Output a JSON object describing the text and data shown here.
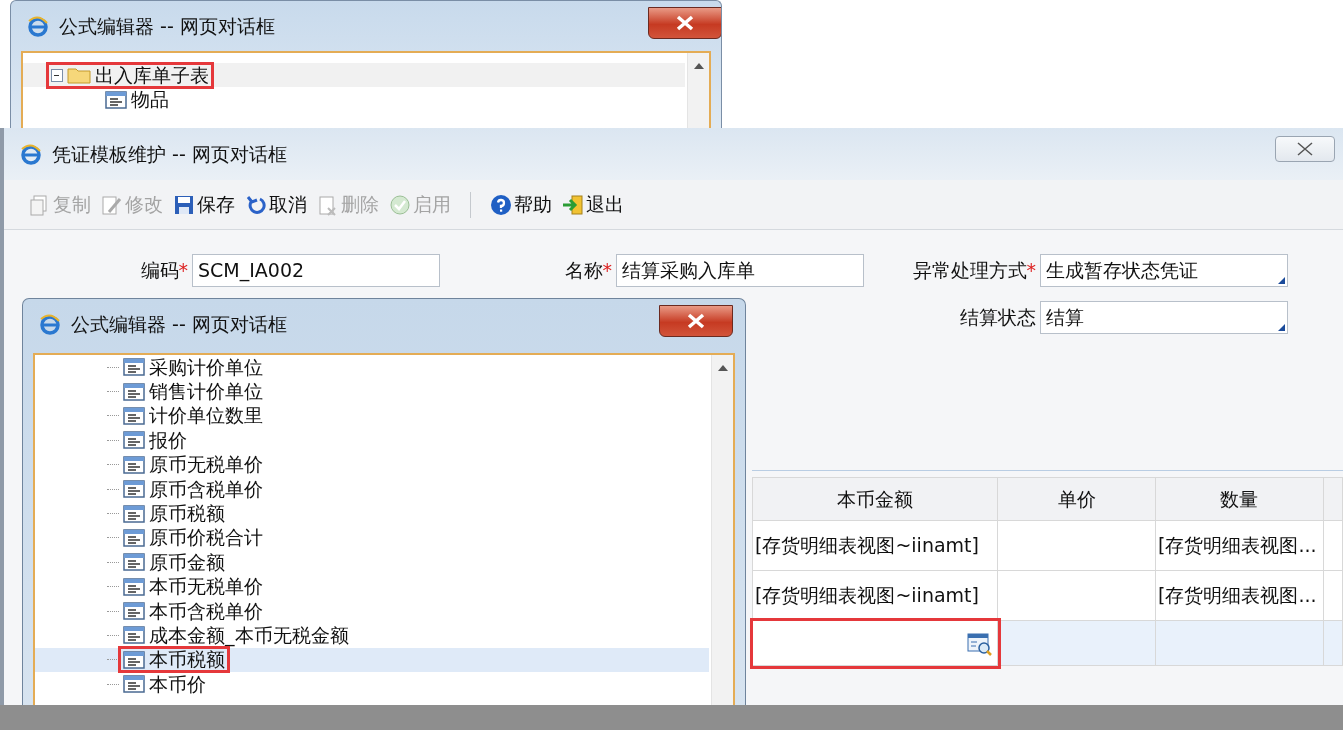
{
  "top_dialog": {
    "title": "公式编辑器 -- 网页对话框",
    "tree": [
      {
        "label": "出入库单子表",
        "kind": "folder",
        "expanded": true,
        "highlighted": true,
        "children": [
          {
            "label": "物品",
            "kind": "field",
            "highlighted": false
          }
        ]
      }
    ]
  },
  "main_window": {
    "title": "凭证模板维护 -- 网页对话框",
    "toolbar": [
      [
        {
          "label": "复制",
          "kind": "copy",
          "disabled": true
        },
        {
          "label": "修改",
          "kind": "edit",
          "disabled": true
        },
        {
          "label": "保存",
          "kind": "save",
          "disabled": false
        },
        {
          "label": "取消",
          "kind": "cancel",
          "disabled": false
        },
        {
          "label": "删除",
          "kind": "delete",
          "disabled": true
        },
        {
          "label": "启用",
          "kind": "enable",
          "disabled": true
        }
      ],
      [
        {
          "label": "帮助",
          "kind": "help",
          "disabled": false
        },
        {
          "label": "退出",
          "kind": "exit",
          "disabled": false
        }
      ]
    ],
    "form": [
      [
        {
          "label": "编码",
          "required_mark": "*",
          "kind": "text",
          "value": "SCM_IA002"
        },
        {
          "label": "名称",
          "required_mark": "*",
          "kind": "text",
          "value": "结算采购入库单"
        },
        {
          "label": "异常处理方式",
          "required_mark": "*",
          "kind": "select",
          "value": "生成暂存状态凭证"
        }
      ],
      [
        {
          "label": "结算状态",
          "kind": "select",
          "value": "结算"
        }
      ]
    ],
    "table": {
      "columns": [
        "本币金额",
        "单价",
        "数量"
      ],
      "rows": [
        {
          "editing": false,
          "cells": [
            "[存货明细表视图~iinamt]",
            "",
            "[存货明细表视图..."
          ]
        },
        {
          "editing": false,
          "cells": [
            "[存货明细表视图~iinamt]",
            "",
            "[存货明细表视图..."
          ]
        },
        {
          "editing": true,
          "highlighted": true,
          "cells": [
            "",
            "",
            ""
          ]
        }
      ]
    }
  },
  "formula_dialog": {
    "title": "公式编辑器 -- 网页对话框",
    "tree": [
      {
        "label": "采购计价单位",
        "selected": false,
        "highlighted": false
      },
      {
        "label": "销售计价单位",
        "selected": false,
        "highlighted": false
      },
      {
        "label": "计价单位数里",
        "selected": false,
        "highlighted": false
      },
      {
        "label": "报价",
        "selected": false,
        "highlighted": false
      },
      {
        "label": "原币无税单价",
        "selected": false,
        "highlighted": false
      },
      {
        "label": "原币含税单价",
        "selected": false,
        "highlighted": false
      },
      {
        "label": "原币税额",
        "selected": false,
        "highlighted": false
      },
      {
        "label": "原币价税合计",
        "selected": false,
        "highlighted": false
      },
      {
        "label": "原币金额",
        "selected": false,
        "highlighted": false
      },
      {
        "label": "本币无税单价",
        "selected": false,
        "highlighted": false
      },
      {
        "label": "本币含税单价",
        "selected": false,
        "highlighted": false
      },
      {
        "label": "成本金额_本币无税金额",
        "selected": false,
        "highlighted": false
      },
      {
        "label": "本币税额",
        "selected": true,
        "highlighted": true
      },
      {
        "label": "本币价",
        "selected": false,
        "highlighted": false
      }
    ]
  }
}
